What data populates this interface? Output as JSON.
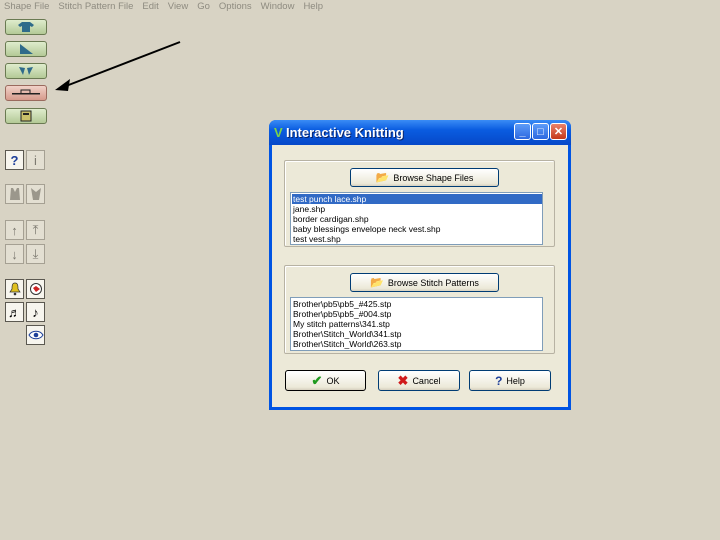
{
  "menu": [
    "Shape File",
    "Stitch Pattern File",
    "Edit",
    "View",
    "Go",
    "Options",
    "Window",
    "Help"
  ],
  "toolbar": {
    "help_icon": "?",
    "info_icon": "i"
  },
  "dialog": {
    "title": "Interactive Knitting",
    "browse_shape_label": "Browse Shape Files",
    "shape_files": [
      "test punch lace.shp",
      "jane.shp",
      "border cardigan.shp",
      "baby blessings envelope neck vest.shp",
      "test vest.shp"
    ],
    "selected_shape_index": 0,
    "browse_stitch_label": "Browse Stitch Patterns",
    "stitch_patterns": [
      "Brother\\pb5\\pb5_#425.stp",
      "Brother\\pb5\\pb5_#004.stp",
      "My stitch patterns\\341.stp",
      "Brother\\Stitch_World\\341.stp",
      "Brother\\Stitch_World\\263.stp"
    ],
    "ok_label": "OK",
    "cancel_label": "Cancel",
    "help_label": "Help"
  }
}
